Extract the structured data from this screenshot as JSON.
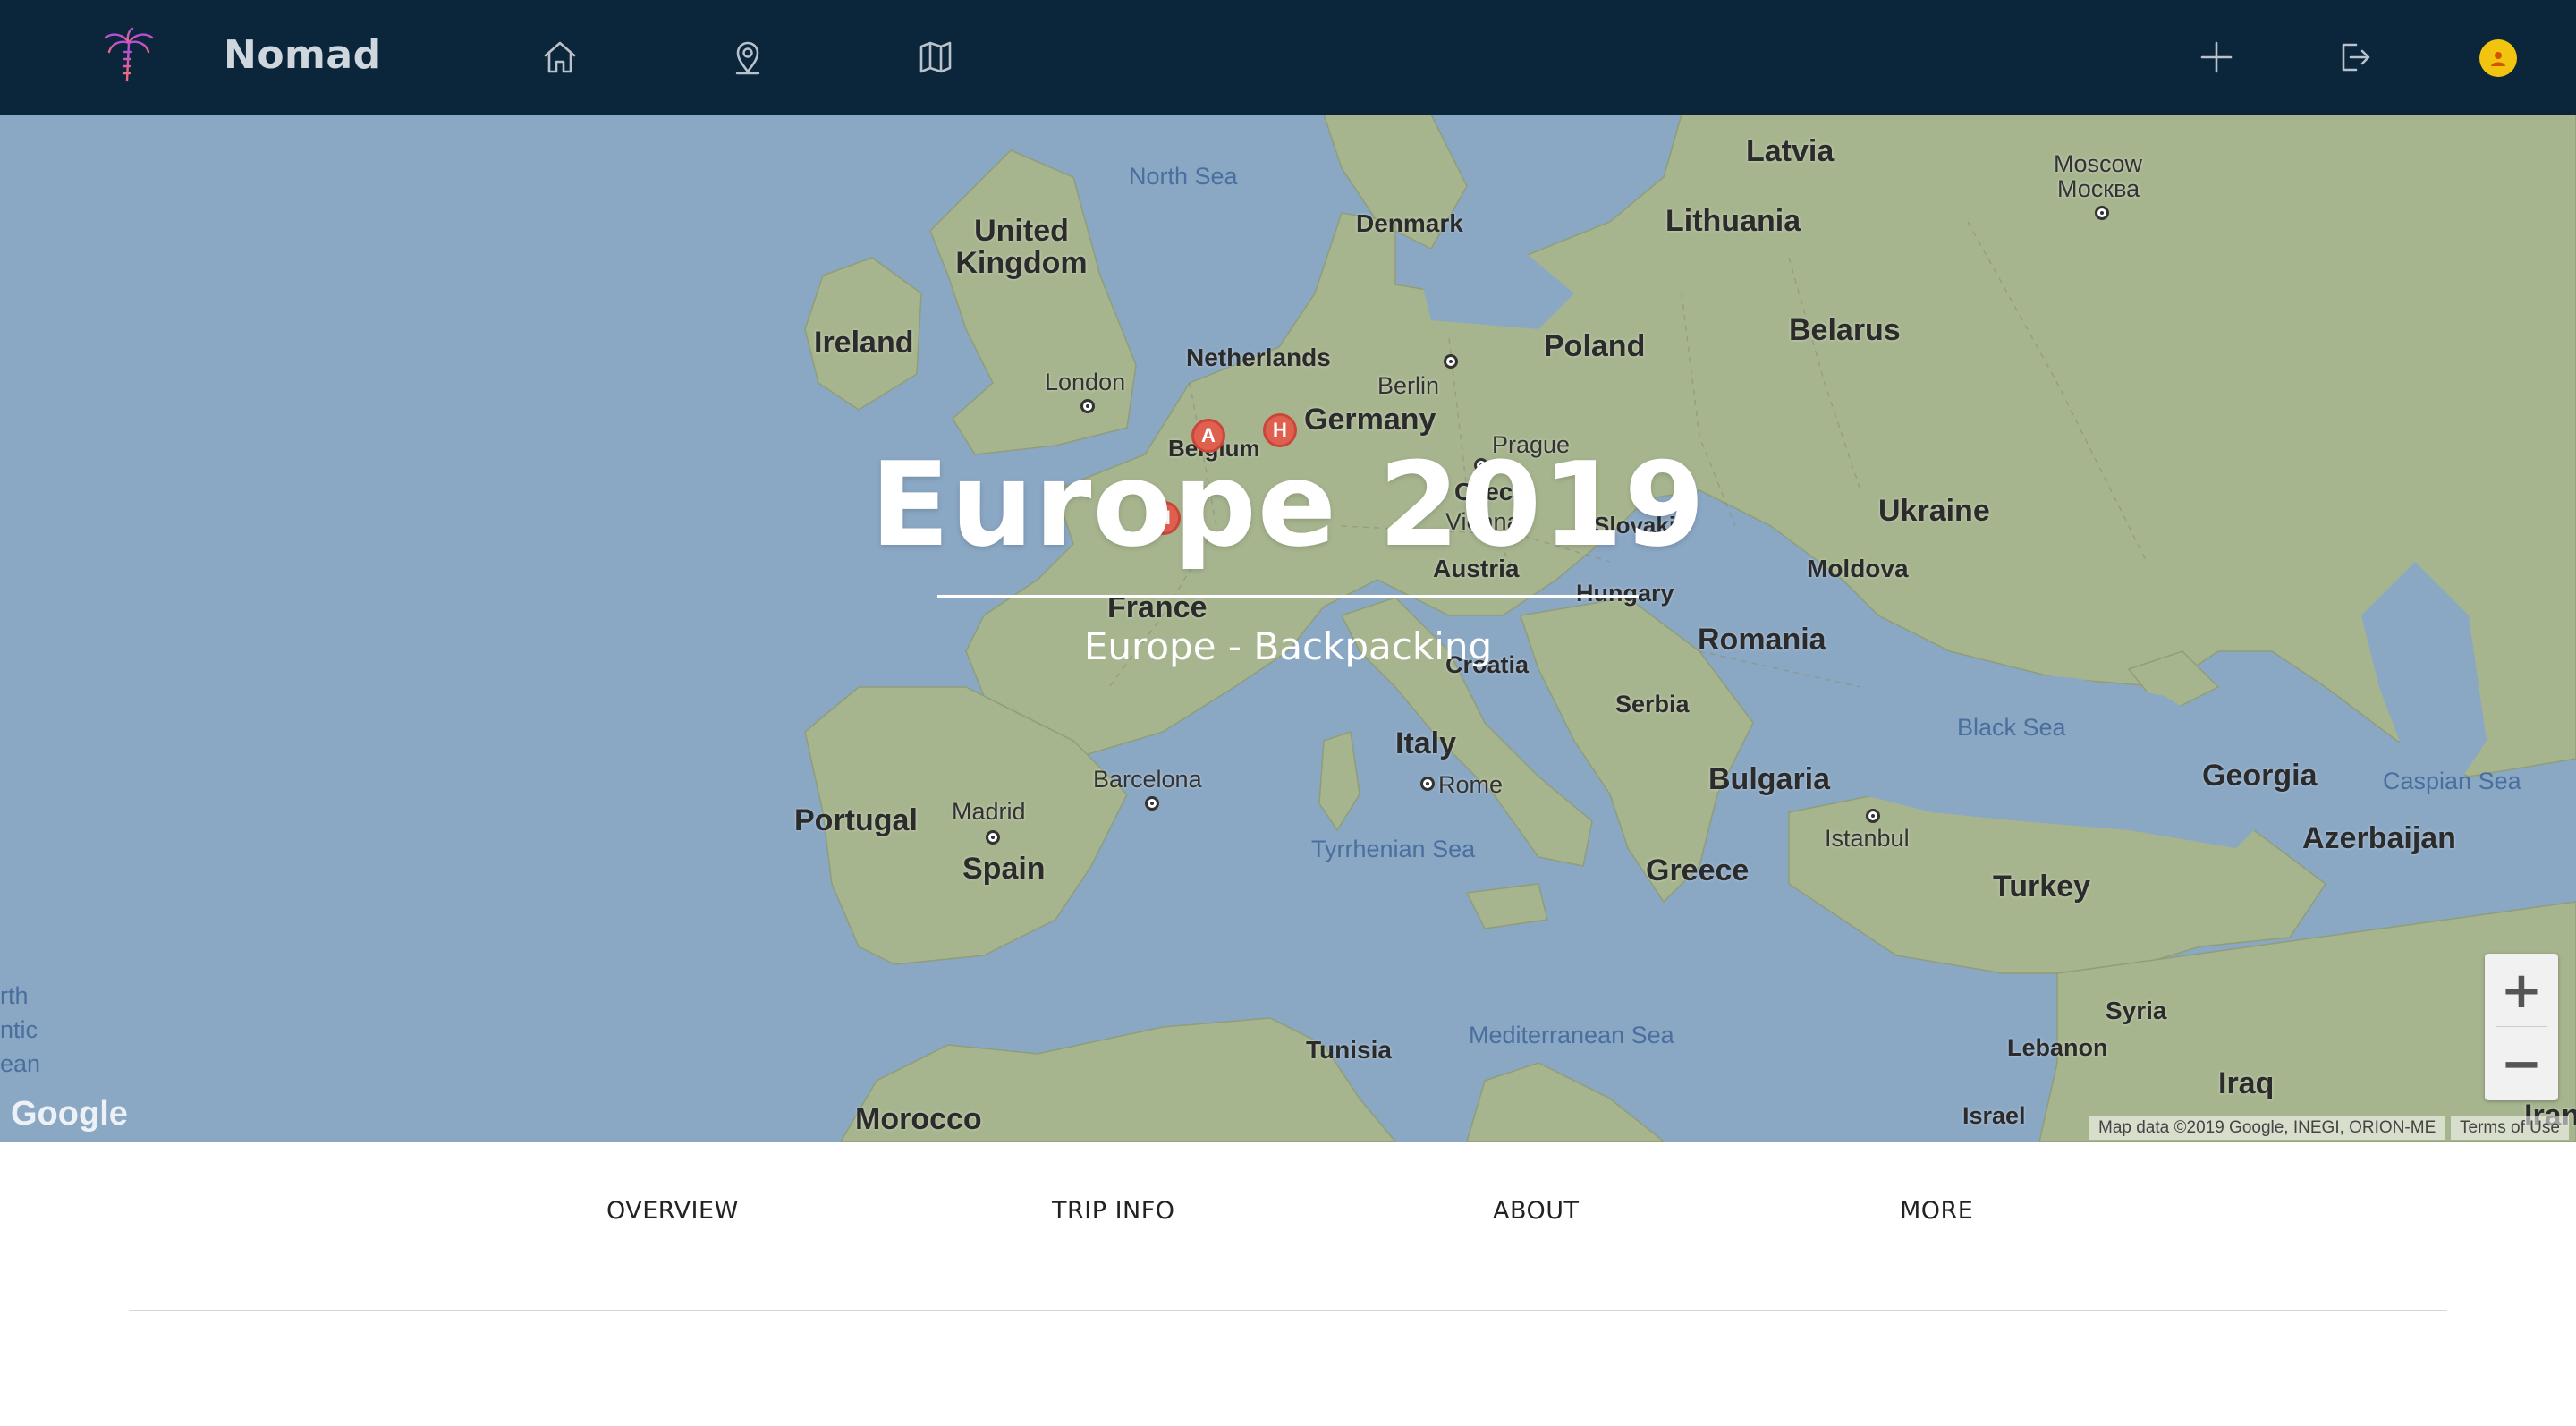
{
  "nav": {
    "brand": "Nomad",
    "icons": [
      "palm-tree-icon",
      "home-icon",
      "map-pin-icon",
      "map-icon",
      "plus-icon",
      "logout-icon",
      "avatar-icon"
    ]
  },
  "hero": {
    "title": "Europe 2019",
    "subtitle": "Europe - Backpacking"
  },
  "map": {
    "countries": [
      "Latvia",
      "Lithuania",
      "Denmark",
      "United Kingdom",
      "Ireland",
      "Netherlands",
      "Belgium",
      "Germany",
      "Poland",
      "Belarus",
      "Ukraine",
      "Czech",
      "Slovakia",
      "Austria",
      "Hungary",
      "Moldova",
      "Romania",
      "France",
      "Croatia",
      "Serbia",
      "Italy",
      "Bulgaria",
      "Georgia",
      "Azerbaijan",
      "Portugal",
      "Spain",
      "Greece",
      "Turkey",
      "Syria",
      "Lebanon",
      "Iraq",
      "Israel",
      "Tunisia",
      "Morocco",
      "Iran"
    ],
    "cities": [
      "Moscow",
      "Москва",
      "London",
      "Berlin",
      "Prague",
      "Vienna",
      "Barcelona",
      "Madrid",
      "Rome",
      "Istanbul"
    ],
    "seas": [
      "North Sea",
      "Black Sea",
      "Caspian Sea",
      "Tyrrhenian Sea",
      "Mediterranean Sea",
      "rth",
      "ntic",
      "ean"
    ],
    "markers": [
      "airbnb-marker",
      "hostel-marker",
      "hostel-marker"
    ],
    "marker_glyphs": [
      "A",
      "H",
      "H"
    ],
    "zoom_in": "+",
    "zoom_out": "−",
    "logo": "Google",
    "attribution": "Map data ©2019 Google, INEGI, ORION-ME",
    "terms": "Terms of Use"
  },
  "tabs": {
    "items": [
      "OVERVIEW",
      "TRIP INFO",
      "ABOUT",
      "MORE"
    ]
  },
  "colors": {
    "navbar": "#0b253b",
    "water": "#8aa7c4",
    "land": "#a7b58f",
    "avatar": "#f1c40f",
    "marker": "#e0604f"
  }
}
